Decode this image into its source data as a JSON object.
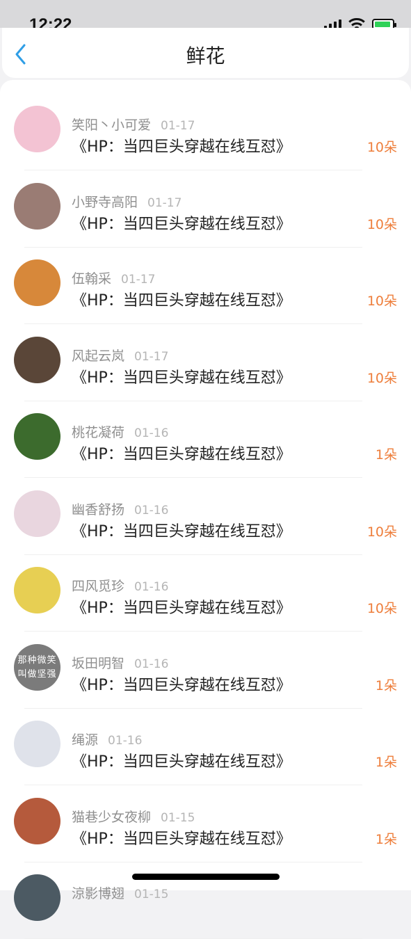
{
  "status_bar": {
    "time": "12:22"
  },
  "header": {
    "title": "鲜花"
  },
  "records": [
    {
      "user": "笑阳丶小可爱",
      "date": "01-17",
      "book": "《HP：当四巨头穿越在线互怼》",
      "amount": "10朵",
      "avatar_color": "#f3c3d3"
    },
    {
      "user": "小野寺高阳",
      "date": "01-17",
      "book": "《HP：当四巨头穿越在线互怼》",
      "amount": "10朵",
      "avatar_color": "#9a7c74"
    },
    {
      "user": "伍翰采",
      "date": "01-17",
      "book": "《HP：当四巨头穿越在线互怼》",
      "amount": "10朵",
      "avatar_color": "#d7883a"
    },
    {
      "user": "风起云岚",
      "date": "01-17",
      "book": "《HP：当四巨头穿越在线互怼》",
      "amount": "10朵",
      "avatar_color": "#5a4638"
    },
    {
      "user": "桃花凝荷",
      "date": "01-16",
      "book": "《HP：当四巨头穿越在线互怼》",
      "amount": "1朵",
      "avatar_color": "#3c6b2d"
    },
    {
      "user": "幽香舒扬",
      "date": "01-16",
      "book": "《HP：当四巨头穿越在线互怼》",
      "amount": "10朵",
      "avatar_color": "#e9d6df"
    },
    {
      "user": "四风觅珍",
      "date": "01-16",
      "book": "《HP：当四巨头穿越在线互怼》",
      "amount": "10朵",
      "avatar_color": "#e7cf53"
    },
    {
      "user": "坂田明智",
      "date": "01-16",
      "book": "《HP：当四巨头穿越在线互怼》",
      "amount": "1朵",
      "avatar_color": "#7b7b7b",
      "avatar_text": "那种微笑 叫做坚强"
    },
    {
      "user": "绳源",
      "date": "01-16",
      "book": "《HP：当四巨头穿越在线互怼》",
      "amount": "1朵",
      "avatar_color": "#dfe2ea"
    },
    {
      "user": "猫巷少女夜柳",
      "date": "01-15",
      "book": "《HP：当四巨头穿越在线互怼》",
      "amount": "1朵",
      "avatar_color": "#b55a3c"
    },
    {
      "user": "涼影博翅",
      "date": "01-15",
      "book": "",
      "amount": "",
      "avatar_color": "#4c5a63"
    }
  ],
  "colors": {
    "accent": "#ee7e3b",
    "back_arrow": "#2f9ee6"
  }
}
